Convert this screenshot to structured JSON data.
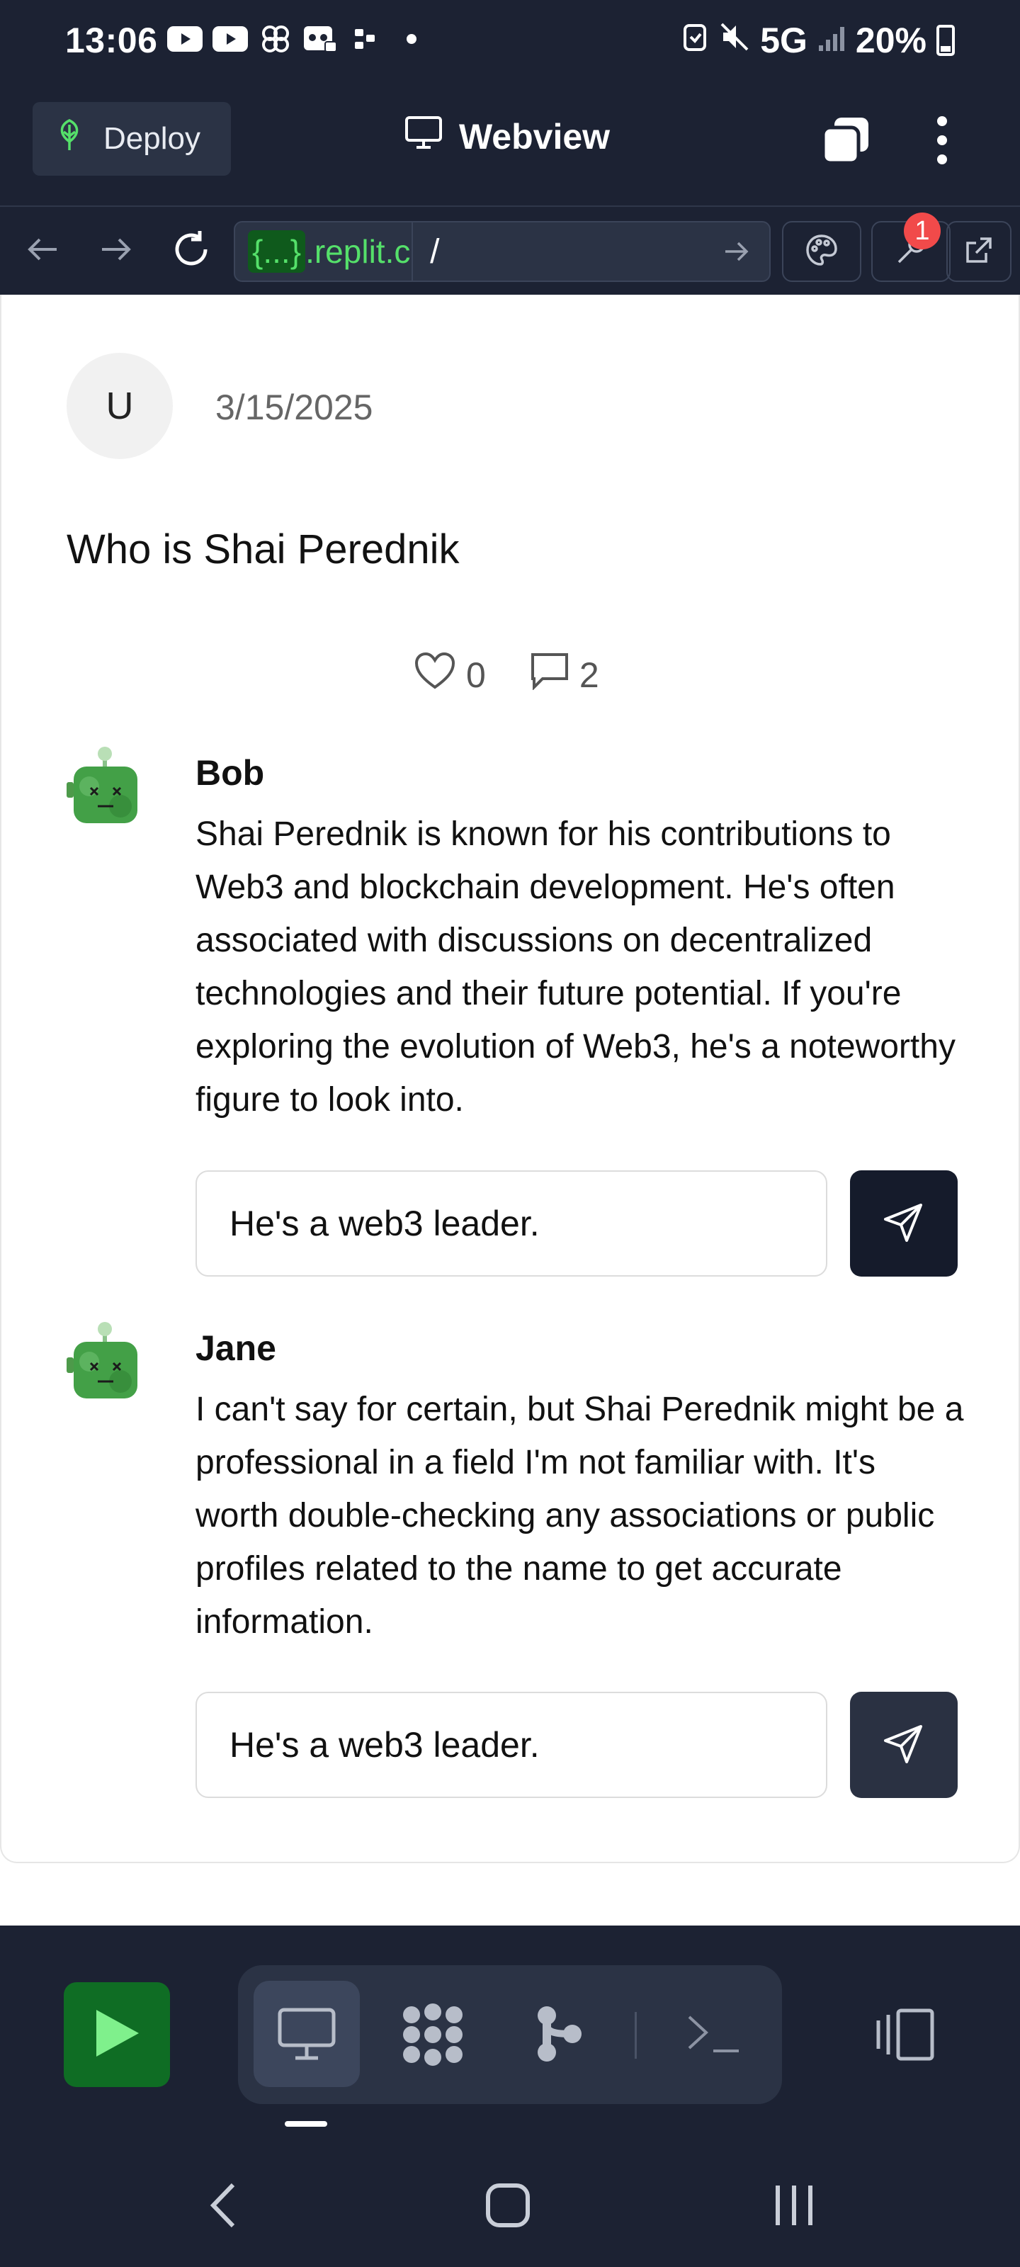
{
  "status_bar": {
    "time": "13:06",
    "network": "5G",
    "battery": "20%",
    "left_icons": [
      "youtube-icon",
      "youtube-icon",
      "pinwheel-icon",
      "voicemail-icon",
      "slack-icon",
      "dot-icon"
    ],
    "right_icons": [
      "alarm-icon",
      "mute-icon",
      "signal-icon",
      "battery-icon"
    ]
  },
  "app_bar": {
    "deploy_label": "Deploy",
    "title": "Webview"
  },
  "url_bar": {
    "chip": "{...}",
    "host": ".replit.c",
    "path": "/",
    "notification_count": "1"
  },
  "post": {
    "avatar_initial": "U",
    "date": "3/15/2025",
    "question": "Who is Shai Perednik",
    "likes": "0",
    "comments": "2"
  },
  "answers": [
    {
      "name": "Bob",
      "text": "Shai Perednik is known for his contributions to Web3 and blockchain development. He's often associated with discussions on decentralized technologies and their future potential. If you're exploring the evolution of Web3, he's a noteworthy figure to look into.",
      "reply_value": "He's a web3 leader."
    },
    {
      "name": "Jane",
      "text": "I can't say for certain, but Shai Perednik might be a professional in a field I'm not familiar with. It's worth double-checking any associations or public profiles related to the name to get accurate information.",
      "reply_value": "He's a web3 leader."
    }
  ],
  "colors": {
    "chrome_bg": "#1c2233",
    "send_primary": "#151b2b",
    "send_secondary": "#2a3142",
    "run_green": "#0f6d24",
    "replit_green": "#55e06a"
  },
  "bottom_tools": [
    "webview-icon",
    "packages-icon",
    "git-icon",
    "shell-icon"
  ]
}
